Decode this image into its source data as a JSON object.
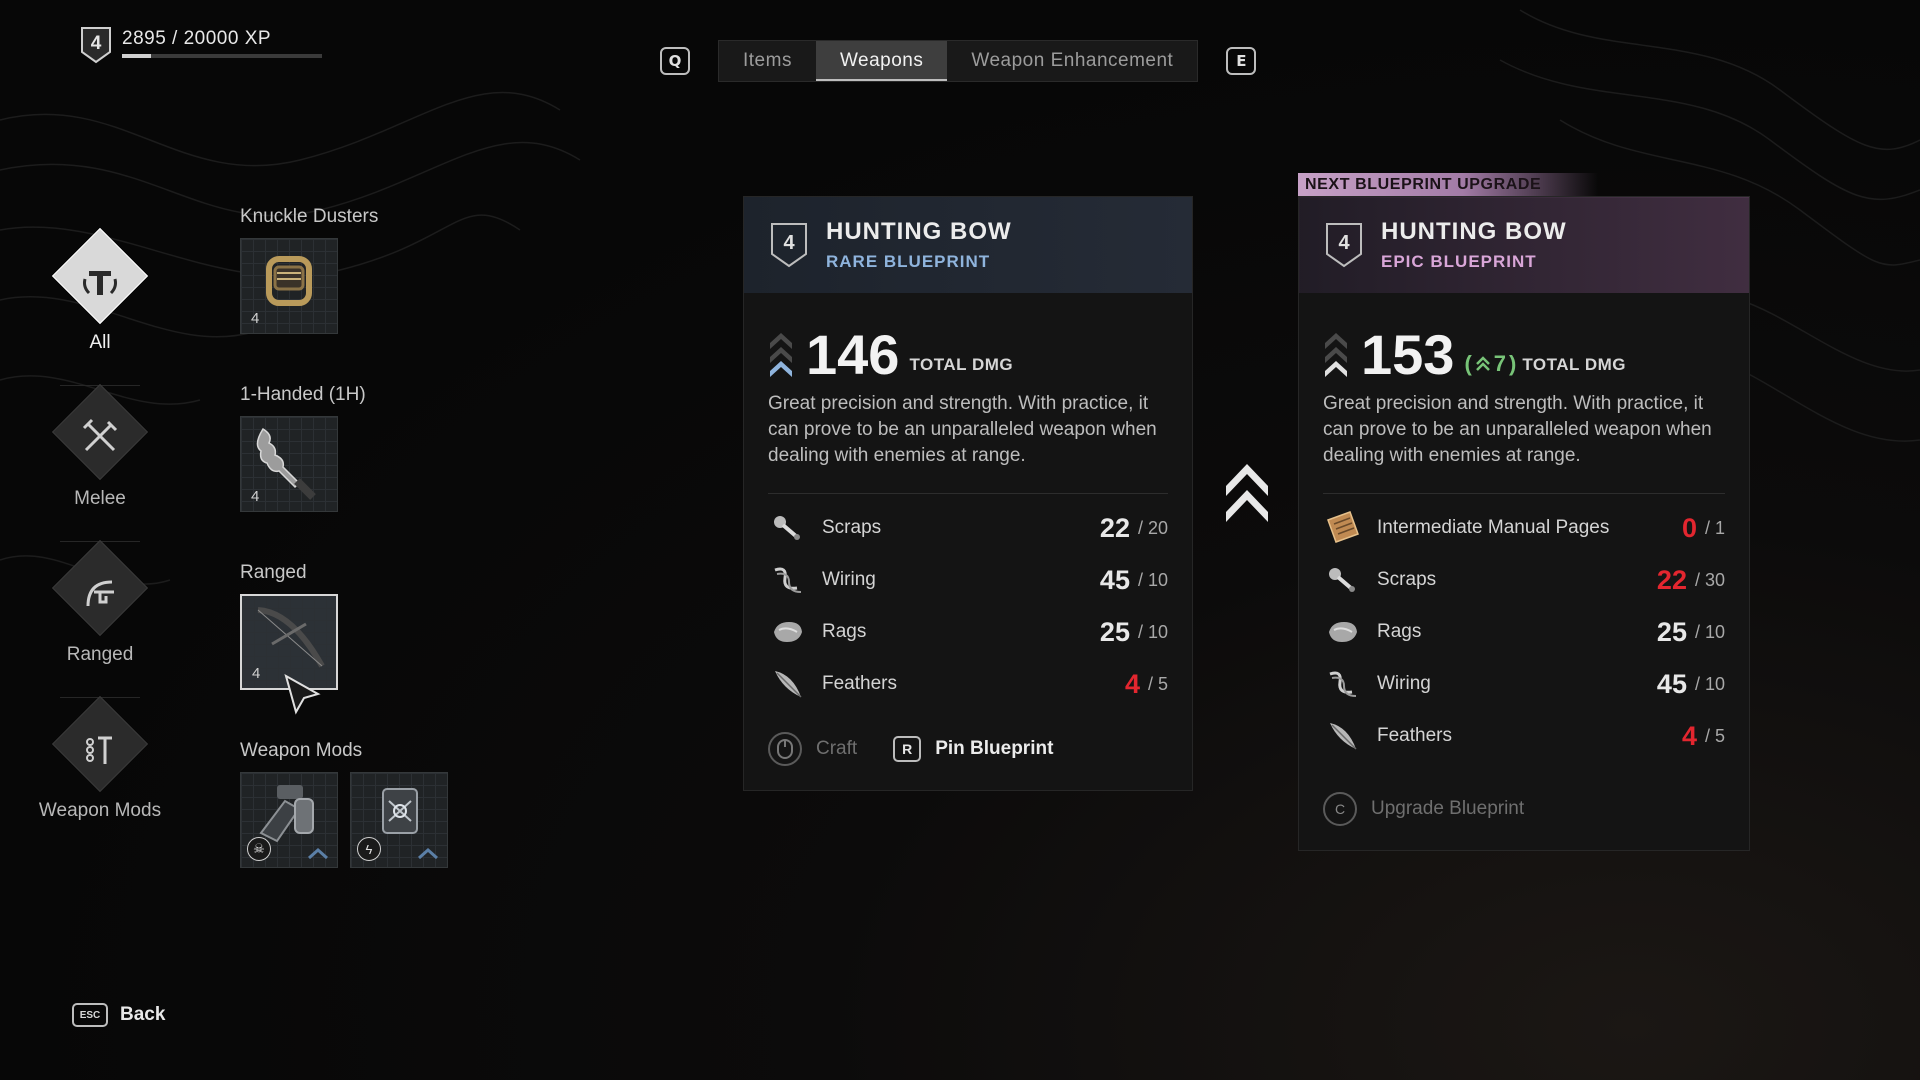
{
  "player": {
    "level": "4",
    "xp_text": "2895 / 20000 XP",
    "xp_progress": 0.145
  },
  "tabs": {
    "prev_key": "Q",
    "next_key": "E",
    "items": [
      {
        "label": "Items",
        "active": false
      },
      {
        "label": "Weapons",
        "active": true
      },
      {
        "label": "Weapon Enhancement",
        "active": false
      }
    ]
  },
  "sidebar": {
    "categories": [
      {
        "label": "All",
        "icon": "weapon-all-icon",
        "active": true
      },
      {
        "label": "Melee",
        "icon": "melee-crossed-icon",
        "active": false
      },
      {
        "label": "Ranged",
        "icon": "ranged-icon",
        "active": false
      },
      {
        "label": "Weapon Mods",
        "icon": "weapon-mods-icon",
        "active": false
      }
    ]
  },
  "groups": [
    {
      "title": "Knuckle Dusters",
      "tiles": [
        {
          "level": "4",
          "icon": "knuckle-dusters-icon"
        }
      ]
    },
    {
      "title": "1-Handed (1H)",
      "tiles": [
        {
          "level": "4",
          "icon": "kris-blade-icon"
        }
      ]
    },
    {
      "title": "Ranged",
      "tiles": [
        {
          "level": "4",
          "icon": "hunting-bow-icon",
          "selected": true
        }
      ]
    },
    {
      "title": "Weapon Mods",
      "tiles": [
        {
          "badge": "☠",
          "icon": "toxic-mod-icon"
        },
        {
          "badge": "ϟ",
          "icon": "electric-mod-icon"
        }
      ]
    }
  ],
  "current": {
    "level": "4",
    "name": "HUNTING BOW",
    "rarity": "RARE BLUEPRINT",
    "damage": "146",
    "damage_label": "TOTAL DMG",
    "description": "Great precision and strength. With practice, it can prove to be an unparalleled weapon when dealing with enemies at range.",
    "resources": [
      {
        "name": "Scraps",
        "have": "22",
        "need": "/ 20",
        "short": false,
        "icon": "scraps-icon"
      },
      {
        "name": "Wiring",
        "have": "45",
        "need": "/ 10",
        "short": false,
        "icon": "wiring-icon"
      },
      {
        "name": "Rags",
        "have": "25",
        "need": "/ 10",
        "short": false,
        "icon": "rags-icon"
      },
      {
        "name": "Feathers",
        "have": "4",
        "need": "/ 5",
        "short": true,
        "icon": "feathers-icon"
      }
    ],
    "craft_label": "Craft",
    "pin_key": "R",
    "pin_label": "Pin Blueprint"
  },
  "next": {
    "banner": "NEXT BLUEPRINT UPGRADE",
    "level": "4",
    "name": "HUNTING BOW",
    "rarity": "EPIC BLUEPRINT",
    "damage": "153",
    "damage_delta": "7",
    "damage_label": "TOTAL DMG",
    "description": "Great precision and strength. With practice, it can prove to be an unparalleled weapon when dealing with enemies at range.",
    "resources": [
      {
        "name": "Intermediate Manual Pages",
        "have": "0",
        "need": "/ 1",
        "short": true,
        "icon": "manual-pages-icon"
      },
      {
        "name": "Scraps",
        "have": "22",
        "need": "/ 30",
        "short": true,
        "icon": "scraps-icon"
      },
      {
        "name": "Rags",
        "have": "25",
        "need": "/ 10",
        "short": false,
        "icon": "rags-icon"
      },
      {
        "name": "Wiring",
        "have": "45",
        "need": "/ 10",
        "short": false,
        "icon": "wiring-icon"
      },
      {
        "name": "Feathers",
        "have": "4",
        "need": "/ 5",
        "short": true,
        "icon": "feathers-icon"
      }
    ],
    "upgrade_key": "C",
    "upgrade_label": "Upgrade Blueprint"
  },
  "back": {
    "key": "ESC",
    "label": "Back"
  },
  "colors": {
    "short": "#e3262f",
    "rare": "#8fb4dd",
    "epic": "#d9a6d8",
    "bonus": "#78c478"
  }
}
